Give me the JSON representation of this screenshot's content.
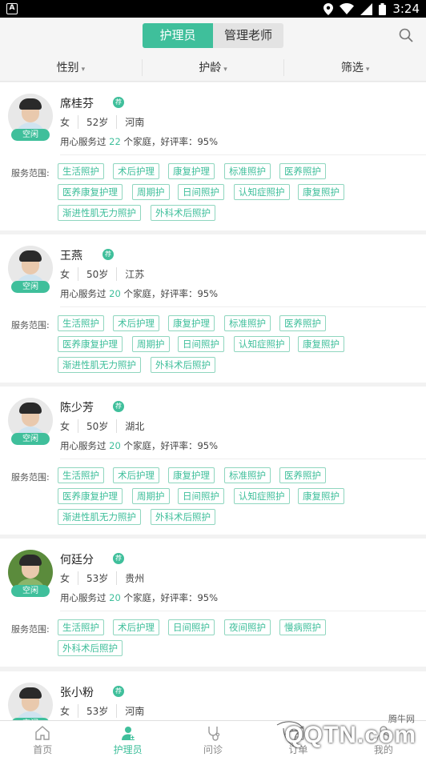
{
  "status_bar": {
    "time": "3:24",
    "app_icon_letter": "A"
  },
  "tabs_top": {
    "active": "护理员",
    "inactive": "管理老师"
  },
  "filters": [
    {
      "label": "性别"
    },
    {
      "label": "护龄"
    },
    {
      "label": "筛选"
    }
  ],
  "recommend_badge": "荐",
  "scope_label": "服务范围:",
  "service_prefix": "用心服务过",
  "service_suffix": "个家庭，好评率：95%",
  "caregivers": [
    {
      "name": "席桂芬",
      "status": "空闲",
      "gender": "女",
      "age": "52岁",
      "province": "河南",
      "families": "22",
      "tags": [
        "生活照护",
        "术后护理",
        "康复护理",
        "标准照护",
        "医养照护",
        "医养康复护理",
        "周期护",
        "日间照护",
        "认知症照护",
        "康复照护",
        "渐进性肌无力照护",
        "外科术后照护"
      ]
    },
    {
      "name": "王燕",
      "status": "空闲",
      "gender": "女",
      "age": "50岁",
      "province": "江苏",
      "families": "20",
      "tags": [
        "生活照护",
        "术后护理",
        "康复护理",
        "标准照护",
        "医养照护",
        "医养康复护理",
        "周期护",
        "日间照护",
        "认知症照护",
        "康复照护",
        "渐进性肌无力照护",
        "外科术后照护"
      ]
    },
    {
      "name": "陈少芳",
      "status": "空闲",
      "gender": "女",
      "age": "50岁",
      "province": "湖北",
      "families": "20",
      "tags": [
        "生活照护",
        "术后护理",
        "康复护理",
        "标准照护",
        "医养照护",
        "医养康复护理",
        "周期护",
        "日间照护",
        "认知症照护",
        "康复照护",
        "渐进性肌无力照护",
        "外科术后照护"
      ]
    },
    {
      "name": "何廷分",
      "status": "空闲",
      "gender": "女",
      "age": "53岁",
      "province": "贵州",
      "families": "20",
      "tags": [
        "生活照护",
        "术后护理",
        "日间照护",
        "夜间照护",
        "慢病照护",
        "外科术后照护"
      ]
    },
    {
      "name": "张小粉",
      "status": "空闲",
      "gender": "女",
      "age": "53岁",
      "province": "河南",
      "families": "",
      "tags": []
    }
  ],
  "bottom_tabs": [
    {
      "label": "首页",
      "icon": "home-icon"
    },
    {
      "label": "护理员",
      "icon": "nurse-icon"
    },
    {
      "label": "问诊",
      "icon": "consult-icon"
    },
    {
      "label": "订单",
      "icon": "order-icon"
    },
    {
      "label": "我的",
      "icon": "profile-icon"
    }
  ],
  "watermark": {
    "text": "QQTN.com",
    "small": "腾牛网"
  },
  "colors": {
    "accent": "#3fbf9b",
    "tag_border": "#8fd6bf"
  }
}
